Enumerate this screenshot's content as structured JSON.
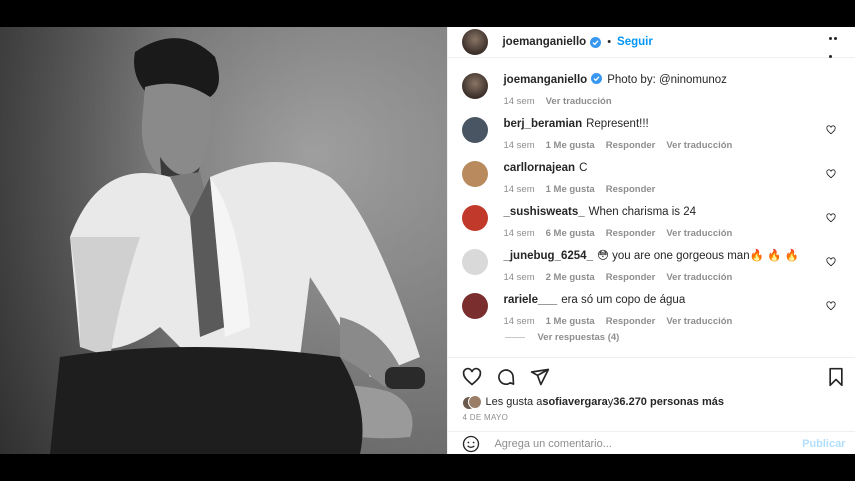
{
  "post": {
    "author": "joemanganiello",
    "follow_label": "Seguir",
    "separator": "•",
    "caption": "Photo by: @ninomunoz",
    "caption_time": "14 sem",
    "caption_translate": "Ver traducción"
  },
  "comments": [
    {
      "user": "berj_beramian",
      "text": "Represent!!!",
      "time": "14 sem",
      "likes": "1 Me gusta",
      "reply": "Responder",
      "translate": "Ver traducción",
      "avatar_color": "#4a5563"
    },
    {
      "user": "carllornajean",
      "text": "C",
      "time": "14 sem",
      "likes": "1 Me gusta",
      "reply": "Responder",
      "translate": "",
      "avatar_color": "#b88a5e"
    },
    {
      "user": "_sushisweats_",
      "text": "When charisma is 24",
      "time": "14 sem",
      "likes": "6 Me gusta",
      "reply": "Responder",
      "translate": "Ver traducción",
      "avatar_color": "#c0392b"
    },
    {
      "user": "_junebug_6254_",
      "text": "😳 you are one gorgeous man🔥 🔥 🔥",
      "time": "14 sem",
      "likes": "2 Me gusta",
      "reply": "Responder",
      "translate": "Ver traducción",
      "avatar_color": "#d9d9d9"
    },
    {
      "user": "rariele___",
      "text": "era só um copo de água",
      "time": "14 sem",
      "likes": "1 Me gusta",
      "reply": "Responder",
      "translate": "Ver traducción",
      "avatar_color": "#7a2e2e"
    }
  ],
  "view_replies": "Ver respuestas (4)",
  "likes": {
    "prefix": "Les gusta a ",
    "user": "sofiavergara",
    "middle": " y ",
    "count": "36.270 personas más"
  },
  "date": "4 DE MAYO",
  "add_comment": {
    "placeholder": "Agrega un comentario...",
    "publish": "Publicar"
  },
  "colors": {
    "accent": "#0095f6",
    "verified": "#3897f0",
    "muted": "#8e8e8e"
  }
}
